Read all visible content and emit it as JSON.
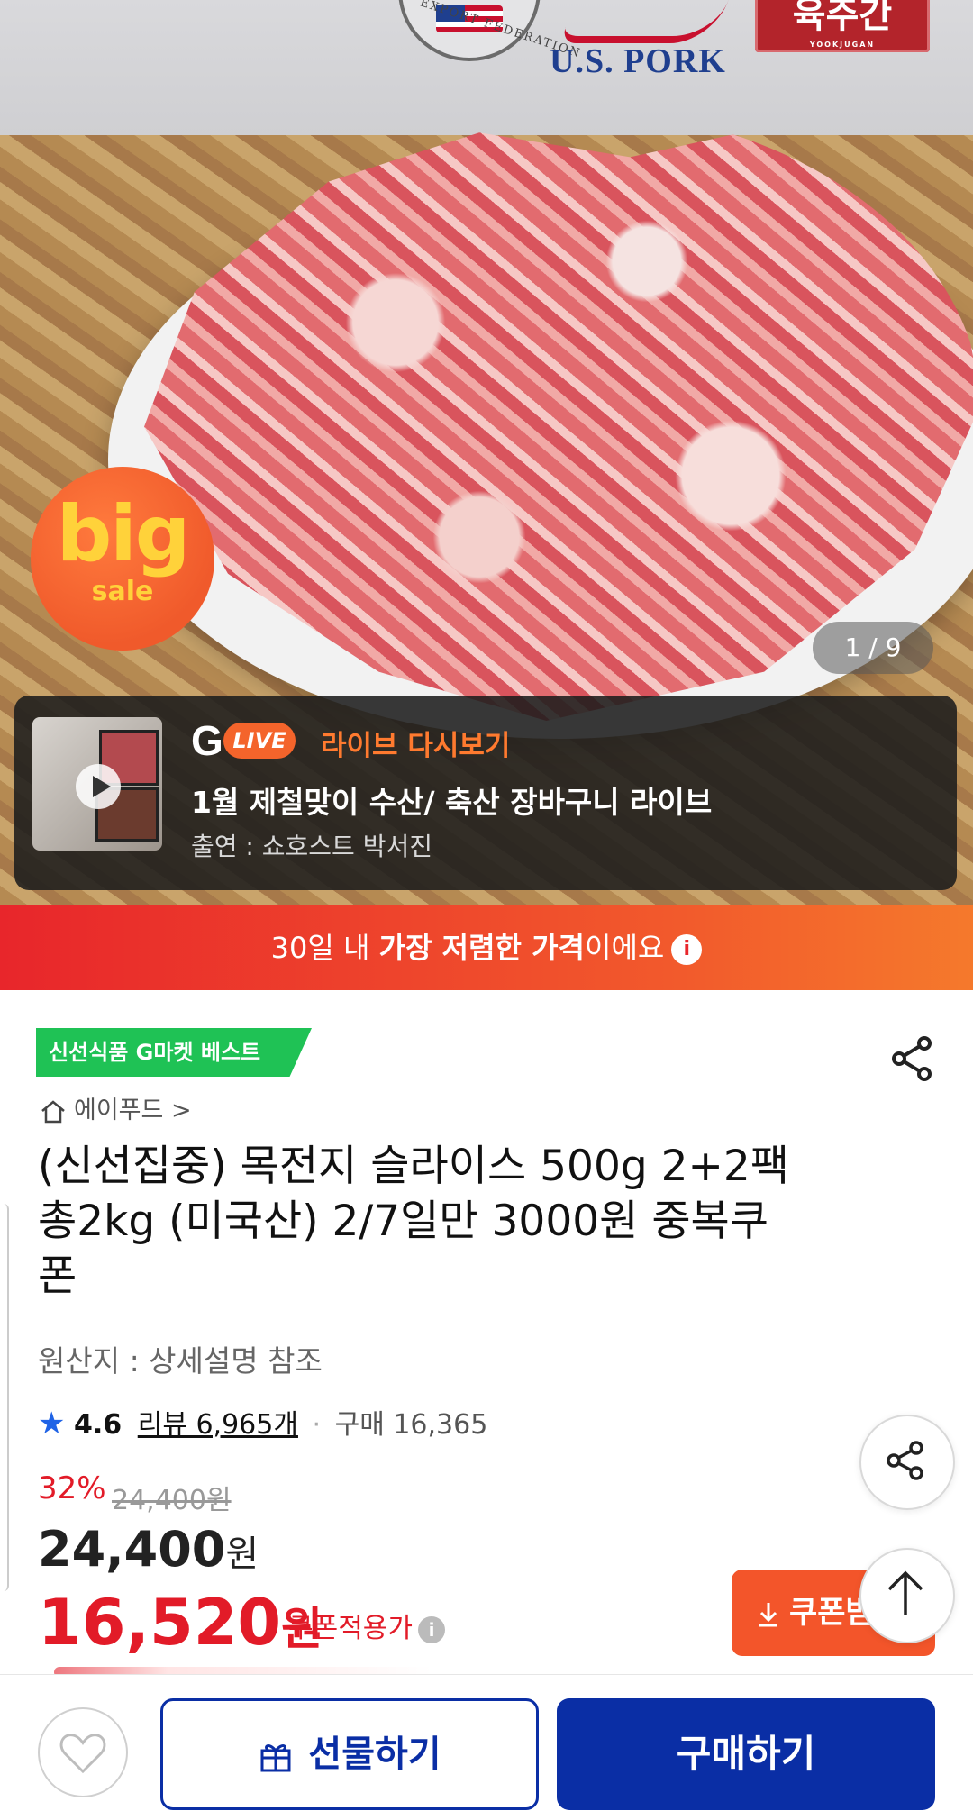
{
  "hero": {
    "seal_text": "EXPORT FEDERATION",
    "brand_us": "U.S. PORK",
    "brand_box": "육주간",
    "brand_box_sub": "YOOKJUGAN",
    "badge_big": "big",
    "badge_sale": "sale",
    "image_counter": "1 / 9"
  },
  "live": {
    "g_letter": "G",
    "live_pill": "LIVE",
    "title": "라이브 다시보기",
    "headline": "1월 제철맞이 수산/ 축산 장바구니 라이브",
    "host": "출연 : 쇼호스트 박서진"
  },
  "strip": {
    "prefix": "30일 내 ",
    "bold": "가장 저렴한 가격",
    "suffix": "이에요",
    "info": "i"
  },
  "product": {
    "best_tag": "신선식품 G마켓 베스트",
    "store": "에이푸드 >",
    "title": "(신선집중) 목전지 슬라이스 500g 2+2팩 총2kg (미국산) 2/7일만 3000원 중복쿠폰",
    "origin": "원산지 : 상세설명 참조",
    "rating": "4.6",
    "review": "리뷰 6,965개",
    "dot": "·",
    "purchases": "구매 16,365",
    "discount": "32%",
    "original_price": "24,400원",
    "price_value": "24,400",
    "price_unit": "원",
    "sale_value": "16,520",
    "sale_unit": "원",
    "coupon_note": "쿠폰적용가",
    "coupon_button": "쿠폰받기"
  },
  "bottom": {
    "gift": "선물하기",
    "buy": "구매하기"
  },
  "colors": {
    "accent_blue": "#0a2ea5",
    "sale_red": "#e21b28",
    "coupon_orange": "#f3552a",
    "best_green": "#1fc255",
    "live_orange": "#ff7a2f"
  },
  "icons": [
    "play-icon",
    "info-icon",
    "share-icon",
    "home-icon",
    "star-icon",
    "arrow-up-icon",
    "download-icon",
    "heart-icon",
    "gift-icon"
  ]
}
